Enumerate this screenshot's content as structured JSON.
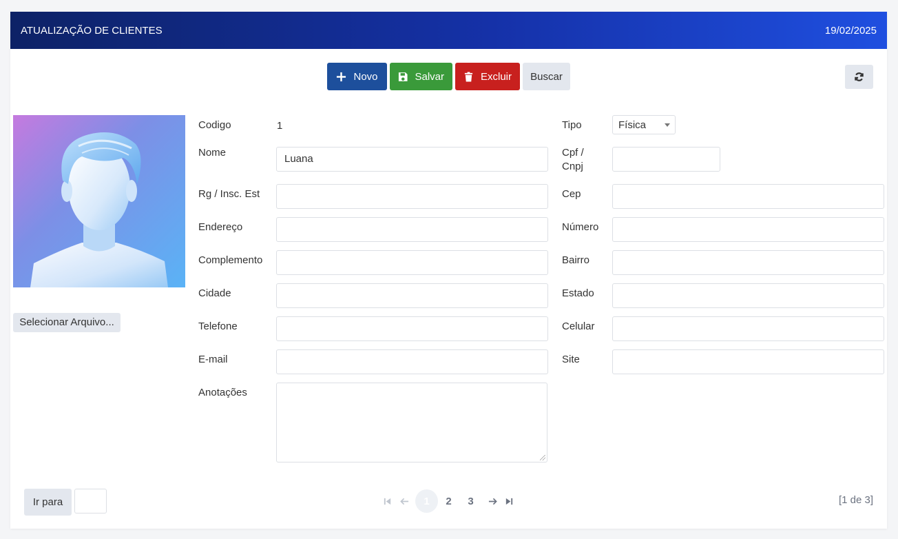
{
  "header": {
    "title": "ATUALIZAÇÃO DE CLIENTES",
    "date": "19/02/2025"
  },
  "toolbar": {
    "novo_label": "Novo",
    "salvar_label": "Salvar",
    "excluir_label": "Excluir",
    "buscar_label": "Buscar"
  },
  "photo": {
    "file_button_label": "Selecionar Arquivo..."
  },
  "form": {
    "codigo": {
      "label": "Codigo",
      "value": "1"
    },
    "tipo": {
      "label": "Tipo",
      "selected": "Física"
    },
    "nome": {
      "label": "Nome",
      "value": "Luana"
    },
    "cpf": {
      "label_line1": "Cpf /",
      "label_line2": "Cnpj",
      "value": ""
    },
    "rg": {
      "label": "Rg / Insc. Est",
      "value": ""
    },
    "cep": {
      "label": "Cep",
      "value": ""
    },
    "endereco": {
      "label": "Endereço",
      "value": ""
    },
    "numero": {
      "label": "Número",
      "value": ""
    },
    "complemento": {
      "label": "Complemento",
      "value": ""
    },
    "bairro": {
      "label": "Bairro",
      "value": ""
    },
    "cidade": {
      "label": "Cidade",
      "value": ""
    },
    "estado": {
      "label": "Estado",
      "value": ""
    },
    "telefone": {
      "label": "Telefone",
      "value": ""
    },
    "celular": {
      "label": "Celular",
      "value": ""
    },
    "email": {
      "label": "E-mail",
      "value": ""
    },
    "site": {
      "label": "Site",
      "value": ""
    },
    "anotacoes": {
      "label": "Anotações",
      "value": ""
    }
  },
  "footer": {
    "goto_label": "Ir para",
    "pages": [
      "1",
      "2",
      "3"
    ],
    "current_page": "1",
    "info": "[1 de 3]"
  },
  "colors": {
    "header_start": "#0d2266",
    "header_end": "#1f4fe0",
    "novo": "#1d4f9c",
    "salvar": "#3a9a3a",
    "excluir": "#c8201e",
    "neutral_button": "#e3e7ee"
  },
  "icons": {
    "novo": "plus-icon",
    "salvar": "save-icon",
    "excluir": "trash-icon",
    "refresh": "refresh-icon",
    "first": "first-page-icon",
    "prev": "arrow-left-icon",
    "next": "arrow-right-icon",
    "last": "last-page-icon"
  }
}
